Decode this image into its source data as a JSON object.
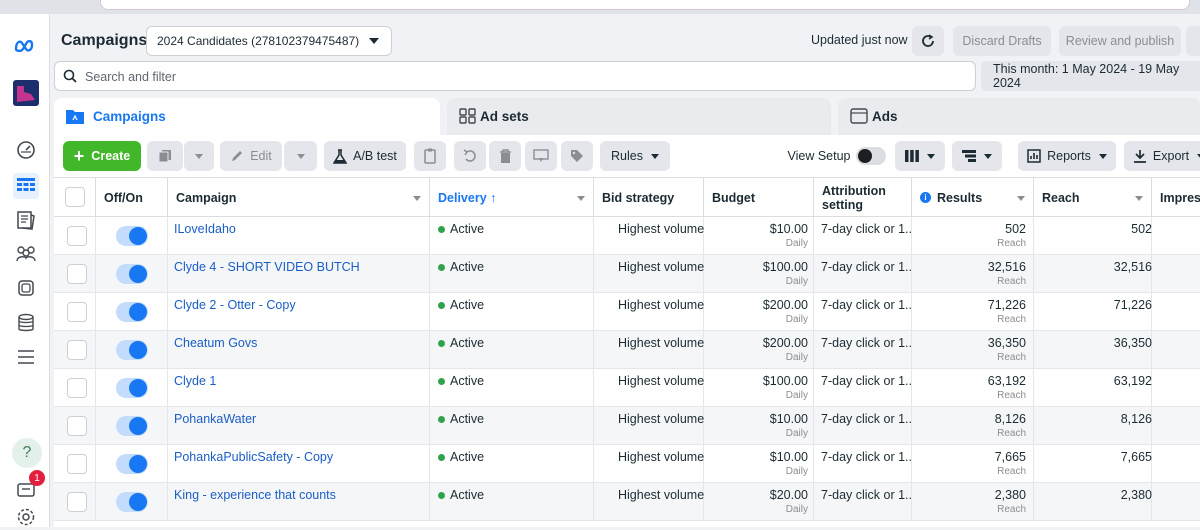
{
  "header": {
    "title": "Campaigns",
    "account": "2024 Candidates (278102379475487)",
    "updated": "Updated just now",
    "discard_label": "Discard Drafts",
    "review_label": "Review and publish"
  },
  "search": {
    "placeholder": "Search and filter"
  },
  "date_range": "This month: 1 May 2024 - 19 May 2024",
  "tabs": [
    {
      "label": "Campaigns"
    },
    {
      "label": "Ad sets"
    },
    {
      "label": "Ads"
    }
  ],
  "toolbar": {
    "create": "Create",
    "edit": "Edit",
    "ab_test": "A/B test",
    "rules": "Rules",
    "view_setup": "View Setup",
    "reports": "Reports",
    "export": "Export"
  },
  "columns": {
    "off_on": "Off/On",
    "campaign": "Campaign",
    "delivery": "Delivery ↑",
    "bid_strategy": "Bid strategy",
    "budget": "Budget",
    "attribution": "Attribution setting",
    "results": "Results",
    "reach": "Reach",
    "impressions": "Impress"
  },
  "rows": [
    {
      "campaign": "ILoveIdaho",
      "delivery": "Active",
      "bid": "Highest volume",
      "budget": "$10.00",
      "budget_period": "Daily",
      "attribution": "7-day click or 1...",
      "results": "502",
      "results_type": "Reach",
      "reach": "502"
    },
    {
      "campaign": "Clyde 4 - SHORT VIDEO BUTCH",
      "delivery": "Active",
      "bid": "Highest volume",
      "budget": "$100.00",
      "budget_period": "Daily",
      "attribution": "7-day click or 1...",
      "results": "32,516",
      "results_type": "Reach",
      "reach": "32,516"
    },
    {
      "campaign": "Clyde 2 - Otter - Copy",
      "delivery": "Active",
      "bid": "Highest volume",
      "budget": "$200.00",
      "budget_period": "Daily",
      "attribution": "7-day click or 1...",
      "results": "71,226",
      "results_type": "Reach",
      "reach": "71,226"
    },
    {
      "campaign": "Cheatum Govs",
      "delivery": "Active",
      "bid": "Highest volume",
      "budget": "$200.00",
      "budget_period": "Daily",
      "attribution": "7-day click or 1...",
      "results": "36,350",
      "results_type": "Reach",
      "reach": "36,350"
    },
    {
      "campaign": "Clyde 1",
      "delivery": "Active",
      "bid": "Highest volume",
      "budget": "$100.00",
      "budget_period": "Daily",
      "attribution": "7-day click or 1...",
      "results": "63,192",
      "results_type": "Reach",
      "reach": "63,192"
    },
    {
      "campaign": "PohankaWater",
      "delivery": "Active",
      "bid": "Highest volume",
      "budget": "$10.00",
      "budget_period": "Daily",
      "attribution": "7-day click or 1...",
      "results": "8,126",
      "results_type": "Reach",
      "reach": "8,126"
    },
    {
      "campaign": "PohankaPublicSafety - Copy",
      "delivery": "Active",
      "bid": "Highest volume",
      "budget": "$10.00",
      "budget_period": "Daily",
      "attribution": "7-day click or 1...",
      "results": "7,665",
      "results_type": "Reach",
      "reach": "7,665"
    },
    {
      "campaign": "King - experience that counts",
      "delivery": "Active",
      "bid": "Highest volume",
      "budget": "$20.00",
      "budget_period": "Daily",
      "attribution": "7-day click or 1...",
      "results": "2,380",
      "results_type": "Reach",
      "reach": "2,380"
    }
  ],
  "notifications": {
    "count": "1"
  },
  "colors": {
    "accent": "#1877f2",
    "create": "#42b72a",
    "active_dot": "#31a24c",
    "link": "#1a5ec6"
  }
}
